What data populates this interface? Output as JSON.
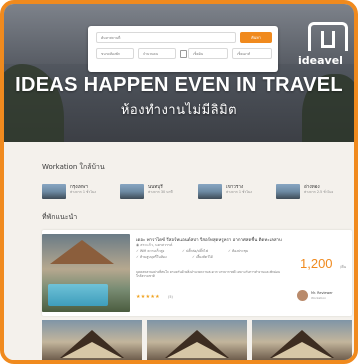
{
  "search": {
    "location_placeholder": "ค้นหาสถานที่",
    "search_button": "ค้นหา",
    "type_placeholder": "ขนาดห้องพัก",
    "type2_placeholder": "จำนวนคน",
    "checkin_placeholder": "เช็คอิน",
    "checkout_placeholder": "เช็คเอาท์"
  },
  "brand": {
    "logo_text": "ideavel"
  },
  "hero": {
    "headline": "IDEAS HAPPEN EVEN IN TRAVEL",
    "subline": "ห้องทำงานไม่มีลิมิต"
  },
  "workation": {
    "title": "Workation ใกล้บ้าน",
    "items": [
      {
        "name": "กรุงเทพฯ",
        "sub": "ห่างจาก 1 ชั่วโมง"
      },
      {
        "name": "นนทบุรี",
        "sub": "ห่างจาก 30 นาที"
      },
      {
        "name": "เขาวราง",
        "sub": "ห่างจาก 1 ชั่วโมง"
      },
      {
        "name": "อ่างทอง",
        "sub": "ห่างจาก 2.5 ชั่วโมง"
      }
    ]
  },
  "recommend": {
    "title": "ที่พักแนะนำ",
    "card": {
      "title": "เดอะ พาราไดซ์ รีสอร์ทแอนด์สปา รีสอร์ทสุดหรูหรา อากาศสดชื่น ติดทะเลสาบ",
      "location": "◉ สระแก้ว, นครสวรรค์",
      "amenities": [
        "✓ Wifi ความเร็วสูง",
        "✓ ปลั๊กต่อ/ปลั๊กไฟ",
        "✓ ห้องประชุม",
        "✓ ห้ามสูบบุหรี่ในห้อง",
        "✓ เลี้ยงสัตว์ได้"
      ],
      "price": "1,200",
      "price_unit": "/คืน",
      "description": "บุคคลหลายอย่างที่สนใจ ครบครันด้วยสิ่งอำนวยความสะดวก บรรยากาศดี เหมาะกับการทำงานและพักผ่อน ใกล้ธรรมชาติ",
      "stars": "★★★★★",
      "reviews": "(5)",
      "reviewer": "Mr. Reviewer",
      "reviewer_sub": "Workation"
    }
  }
}
